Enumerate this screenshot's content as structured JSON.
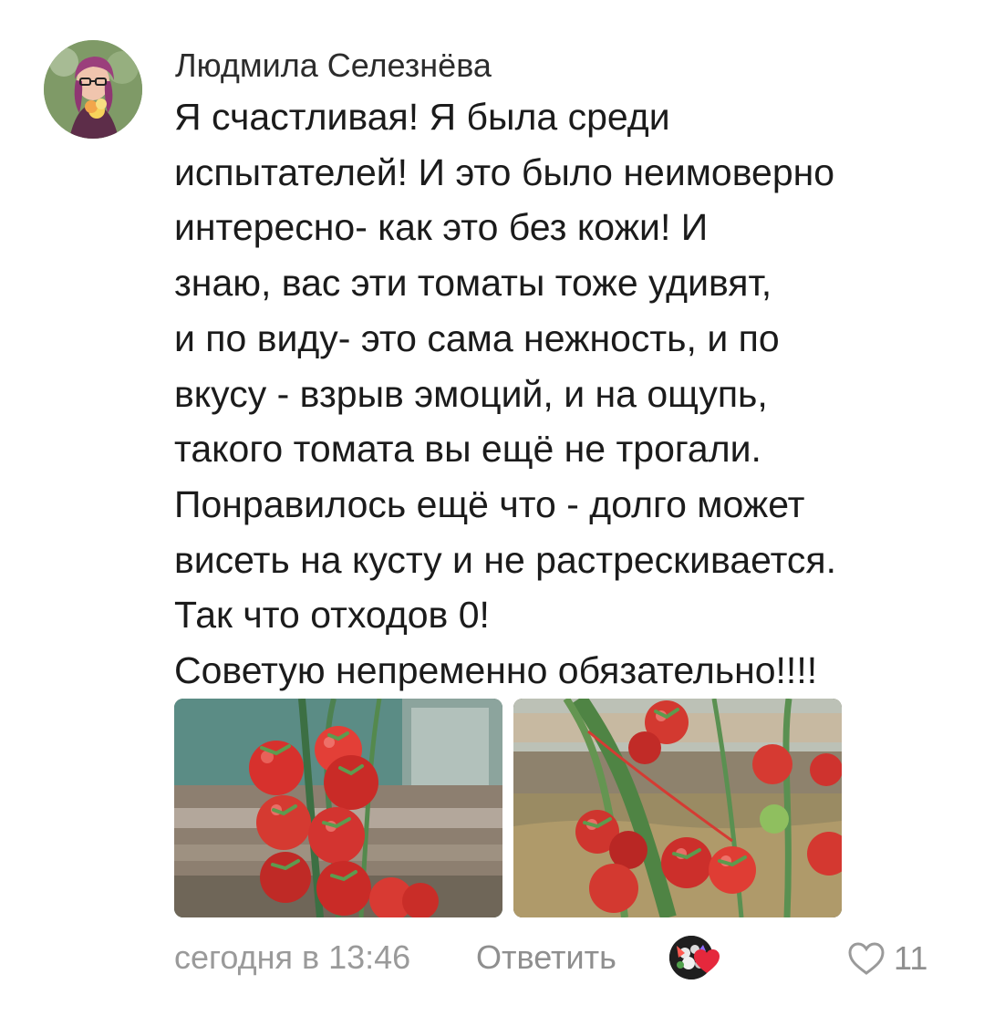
{
  "comment": {
    "author": "Людмила Селезнёва",
    "text": "Я счастливая! Я была среди\nиспытателей! И это было неимоверно\nинтересно- как это без кожи! И\nзнаю, вас эти томаты тоже удивят,\nи по виду- это сама нежность, и по\nвкусу - взрыв эмоций, и на ощупь,\nтакого томата вы ещё не трогали.\nПонравилось ещё что - долго может\nвисеть на кусту и не растрескивается.\nТак что отходов 0!\nСоветую непременно обязательно!!!!",
    "timestamp": "сегодня в 13:46",
    "reply_label": "Ответить",
    "likes": "11"
  },
  "icons": {
    "avatar": "user-avatar",
    "reaction_heart": "heart-icon",
    "like": "heart-outline-icon"
  },
  "colors": {
    "text": "#1b1b1b",
    "meta": "#9a9a9a",
    "reaction": "#e5283c"
  }
}
